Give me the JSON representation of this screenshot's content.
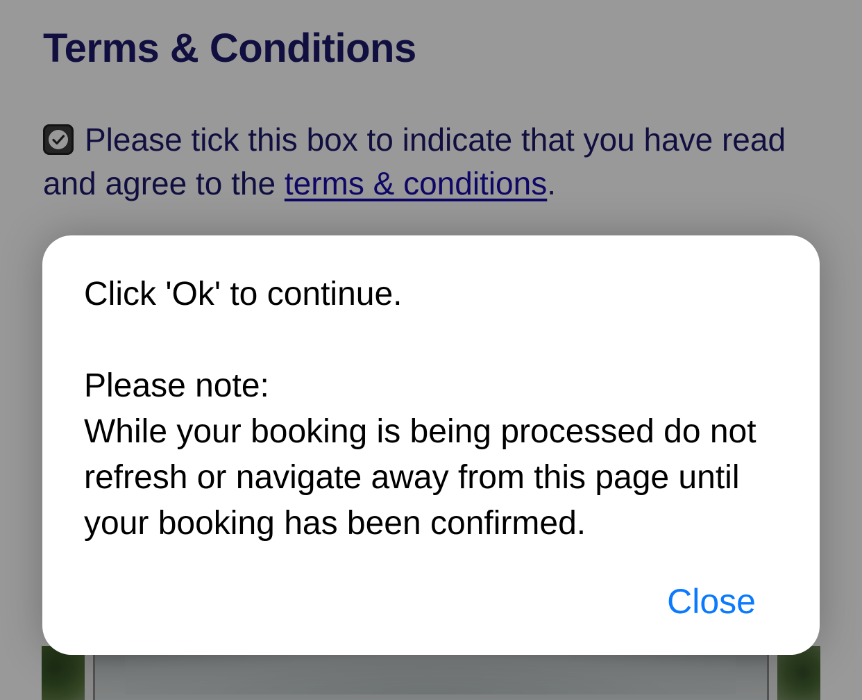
{
  "page": {
    "title": "Terms & Conditions",
    "terms_text_before": "Please tick this box to indicate that you have read and agree to the ",
    "terms_link": "terms & conditions",
    "terms_text_after": ".",
    "checkbox_checked": true
  },
  "dialog": {
    "message_line1": "Click 'Ok' to continue.",
    "message_note_heading": "Please note:",
    "message_note_body": "While your booking is being processed do not refresh or navigate away from this page until your booking has been confirmed.",
    "close_label": "Close"
  },
  "colors": {
    "heading": "#1d1a6b",
    "link": "#1a0dab",
    "dialog_action": "#0a7aff",
    "overlay": "rgba(0,0,0,0.40)"
  },
  "icons": {
    "checkbox": "checkbox-checked-icon"
  }
}
